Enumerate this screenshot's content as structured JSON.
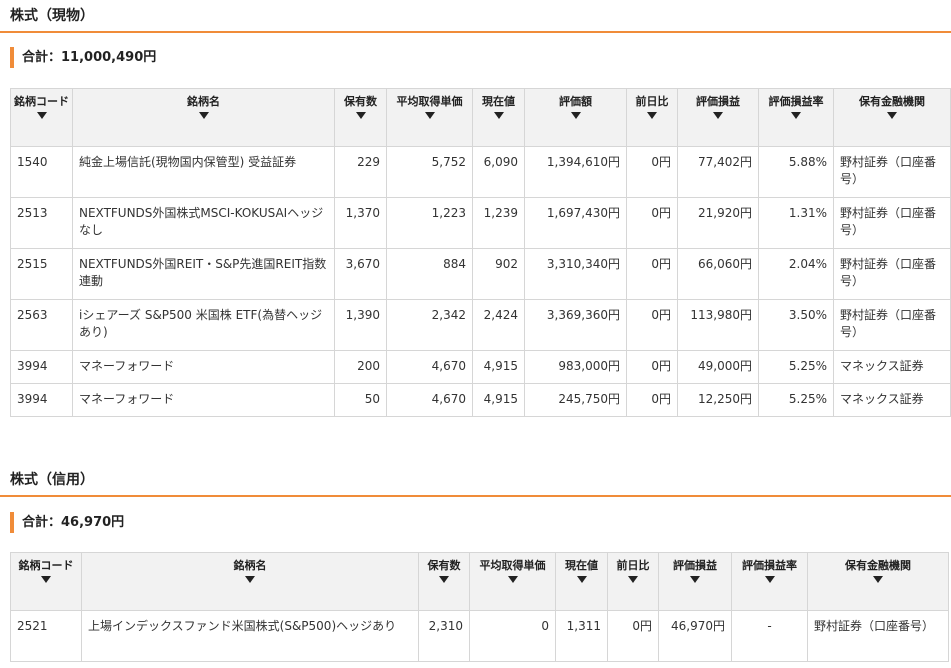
{
  "sections": {
    "spot": {
      "title": "株式（現物）",
      "total": "合計：11,000,490円"
    },
    "margin": {
      "title": "株式（信用）",
      "total": "合計：46,970円"
    }
  },
  "spot_table": {
    "headers": {
      "code": "銘柄コード",
      "name": "銘柄名",
      "qty": "保有数",
      "avg": "平均取得単価",
      "price": "現在値",
      "value": "評価額",
      "daychg": "前日比",
      "pl": "評価損益",
      "plrate": "評価損益率",
      "broker": "保有金融機関"
    },
    "rows": [
      {
        "code": "1540",
        "name": "純金上場信託(現物国内保管型) 受益証券",
        "qty": "229",
        "avg": "5,752",
        "price": "6,090",
        "value": "1,394,610円",
        "daychg": "0円",
        "pl": "77,402円",
        "plrate": "5.88%",
        "broker": "野村証券（口座番号）"
      },
      {
        "code": "2513",
        "name": "NEXTFUNDS外国株式MSCI-KOKUSAIヘッジなし",
        "qty": "1,370",
        "avg": "1,223",
        "price": "1,239",
        "value": "1,697,430円",
        "daychg": "0円",
        "pl": "21,920円",
        "plrate": "1.31%",
        "broker": "野村証券（口座番号）"
      },
      {
        "code": "2515",
        "name": "NEXTFUNDS外国REIT・S&P先進国REIT指数連動",
        "qty": "3,670",
        "avg": "884",
        "price": "902",
        "value": "3,310,340円",
        "daychg": "0円",
        "pl": "66,060円",
        "plrate": "2.04%",
        "broker": "野村証券（口座番号）"
      },
      {
        "code": "2563",
        "name": "iシェアーズ S&P500 米国株 ETF(為替ヘッジあり)",
        "qty": "1,390",
        "avg": "2,342",
        "price": "2,424",
        "value": "3,369,360円",
        "daychg": "0円",
        "pl": "113,980円",
        "plrate": "3.50%",
        "broker": "野村証券（口座番号）"
      },
      {
        "code": "3994",
        "name": "マネーフォワード",
        "qty": "200",
        "avg": "4,670",
        "price": "4,915",
        "value": "983,000円",
        "daychg": "0円",
        "pl": "49,000円",
        "plrate": "5.25%",
        "broker": "マネックス証券"
      },
      {
        "code": "3994",
        "name": "マネーフォワード",
        "qty": "50",
        "avg": "4,670",
        "price": "4,915",
        "value": "245,750円",
        "daychg": "0円",
        "pl": "12,250円",
        "plrate": "5.25%",
        "broker": "マネックス証券"
      }
    ]
  },
  "margin_table": {
    "headers": {
      "code": "銘柄コード",
      "name": "銘柄名",
      "qty": "保有数",
      "avg": "平均取得単価",
      "price": "現在値",
      "daychg": "前日比",
      "pl": "評価損益",
      "plrate": "評価損益率",
      "broker": "保有金融機関"
    },
    "rows": [
      {
        "code": "2521",
        "name": "上場インデックスファンド米国株式(S&P500)ヘッジあり",
        "qty": "2,310",
        "avg": "0",
        "price": "1,311",
        "daychg": "0円",
        "pl": "46,970円",
        "plrate": "-",
        "broker": "野村証券（口座番号）"
      }
    ]
  },
  "colors": {
    "accent": "#f08c39",
    "negative_red": "#d33a3a",
    "positive_blue": "#3b6db5",
    "header_bg": "#f2f2f2"
  },
  "icons": {
    "sort": "sort-down-triangle-icon"
  }
}
